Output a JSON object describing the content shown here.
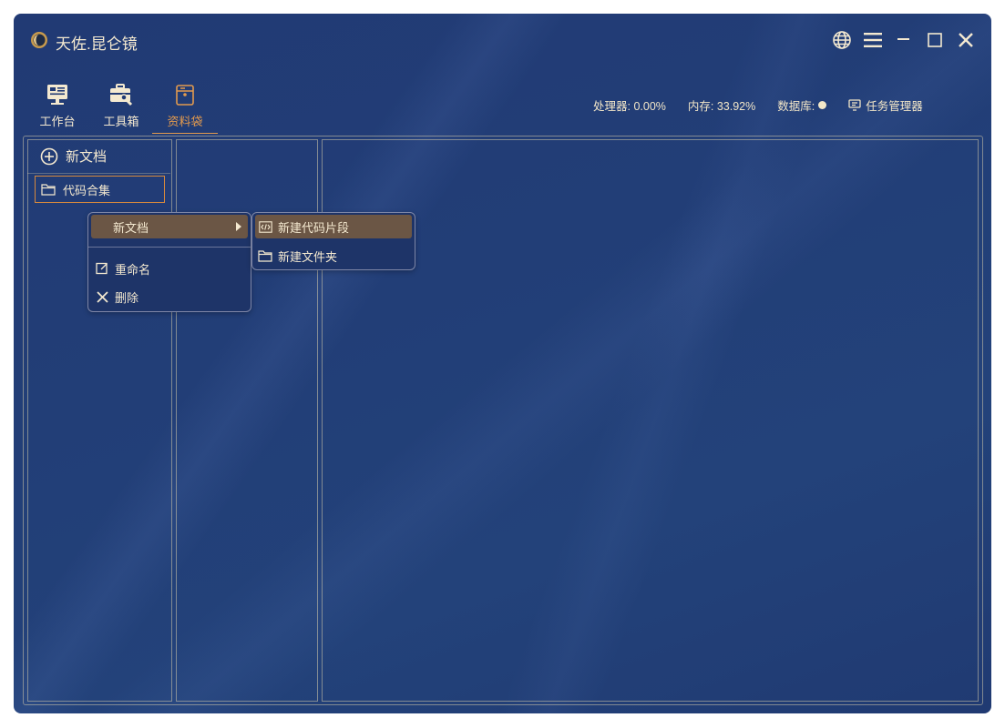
{
  "app": {
    "title": "天佐.昆仑镜"
  },
  "toolbar": {
    "items": [
      {
        "label": "工作台",
        "icon": "workbench-icon"
      },
      {
        "label": "工具箱",
        "icon": "toolbox-icon"
      },
      {
        "label": "资料袋",
        "icon": "document-bag-icon",
        "active": true
      }
    ]
  },
  "status": {
    "cpu": "处理器: 0.00%",
    "memory": "内存: 33.92%",
    "database": "数据库:",
    "task_manager": "任务管理器"
  },
  "sidebar": {
    "new_doc": "新文档",
    "folders": [
      {
        "label": "代码合集"
      }
    ]
  },
  "context_menu": {
    "items": [
      {
        "label": "新文档",
        "has_submenu": true
      },
      {
        "label": "重命名",
        "icon": "edit-icon"
      },
      {
        "label": "删除",
        "icon": "close-icon"
      }
    ]
  },
  "submenu": {
    "items": [
      {
        "label": "新建代码片段",
        "icon": "code-icon"
      },
      {
        "label": "新建文件夹",
        "icon": "folder-icon"
      }
    ]
  },
  "colors": {
    "accent": "#e29a4e",
    "background": "#213a74",
    "text": "#f4e9d0",
    "highlight": "#6b5645"
  }
}
